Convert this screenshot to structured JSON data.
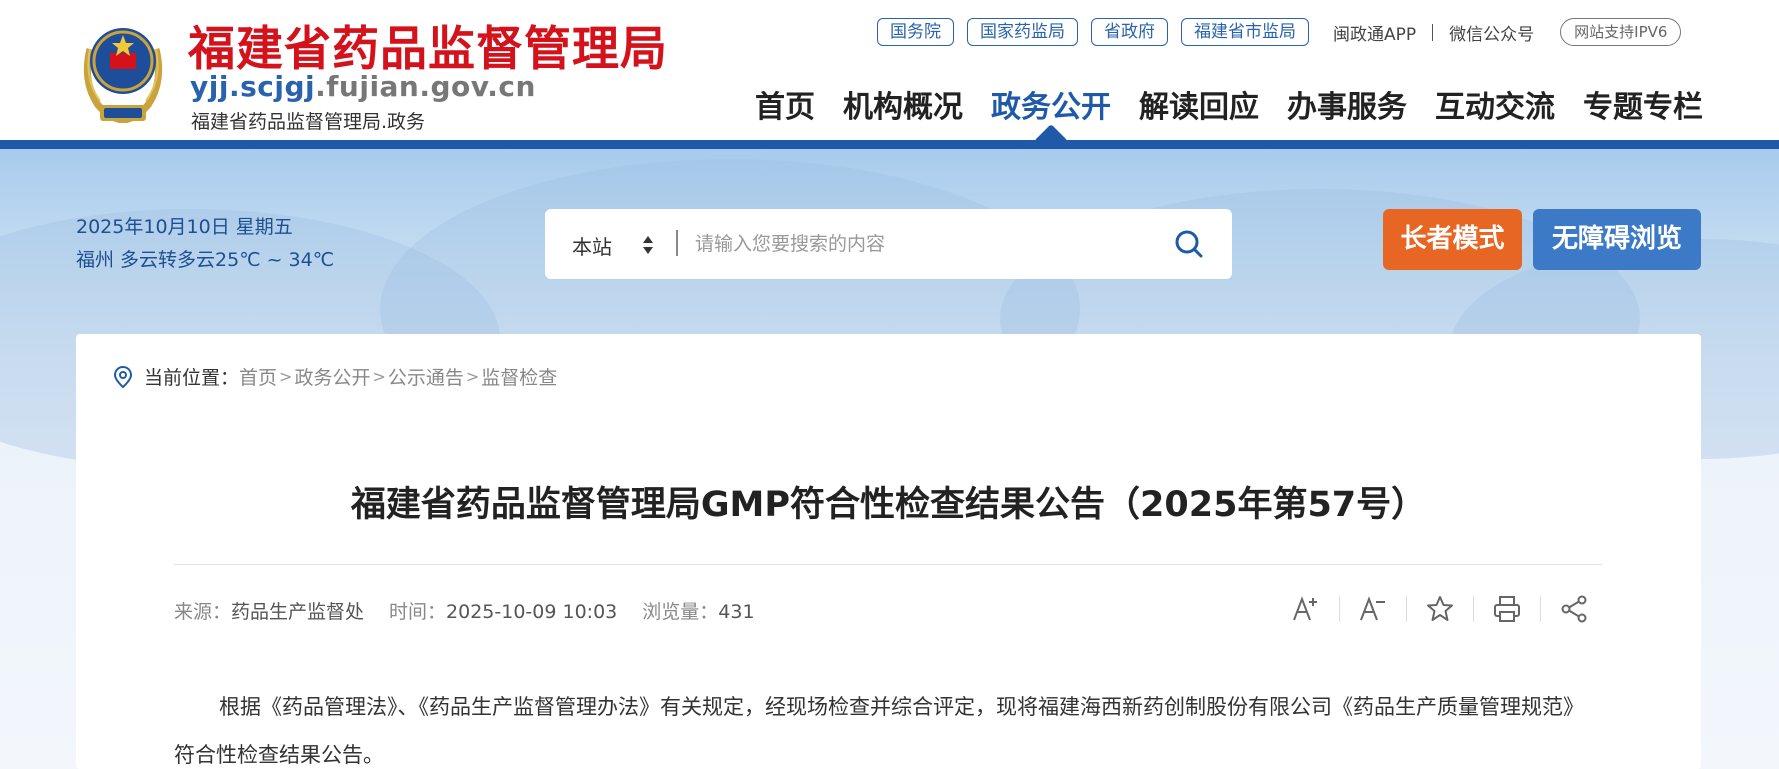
{
  "header": {
    "title": "福建省药品监督管理局",
    "domain_highlight": "yjj.scjgj",
    "domain_rest": ".fujian.gov.cn",
    "subtitle": "福建省药品监督管理局.政务",
    "top_links": [
      "国务院",
      "国家药监局",
      "省政府",
      "福建省市监局"
    ],
    "app_link": "闽政通APP",
    "wechat_link": "微信公众号",
    "ipv6_badge": "网站支持IPV6",
    "nav": [
      "首页",
      "机构概况",
      "政务公开",
      "解读回应",
      "办事服务",
      "互动交流",
      "专题专栏"
    ],
    "active_nav": "政务公开",
    "brand_color": "#1f5aa8",
    "title_color": "#d3121b"
  },
  "banner": {
    "date": "2025年10月10日  星期五",
    "weather": "福州  多云转多云25℃ ~ 34℃",
    "search": {
      "scope": "本站",
      "placeholder": "请输入您要搜索的内容"
    },
    "elder_mode": "长者模式",
    "accessible": "无障碍浏览",
    "elder_color": "#e86624",
    "accessible_color": "#3c79c7"
  },
  "breadcrumb": {
    "label": "当前位置：",
    "items": [
      "首页",
      "政务公开",
      "公示通告",
      "监督检查"
    ],
    "separator": ">"
  },
  "article": {
    "title": "福建省药品监督管理局GMP符合性检查结果公告（2025年第57号）",
    "source_label": "来源：",
    "source": "药品生产监督处",
    "time_label": "时间：",
    "time": "2025-10-09 10:03",
    "views_label": "浏览量：",
    "views": "431",
    "tools": [
      "font-increase-icon",
      "font-decrease-icon",
      "favorite-star-icon",
      "print-icon",
      "share-icon"
    ],
    "paragraph": "根据《药品管理法》、《药品生产监督管理办法》有关规定，经现场检查并综合评定，现将福建海西新药创制股份有限公司《药品生产质量管理规范》符合性检查结果公告。"
  }
}
